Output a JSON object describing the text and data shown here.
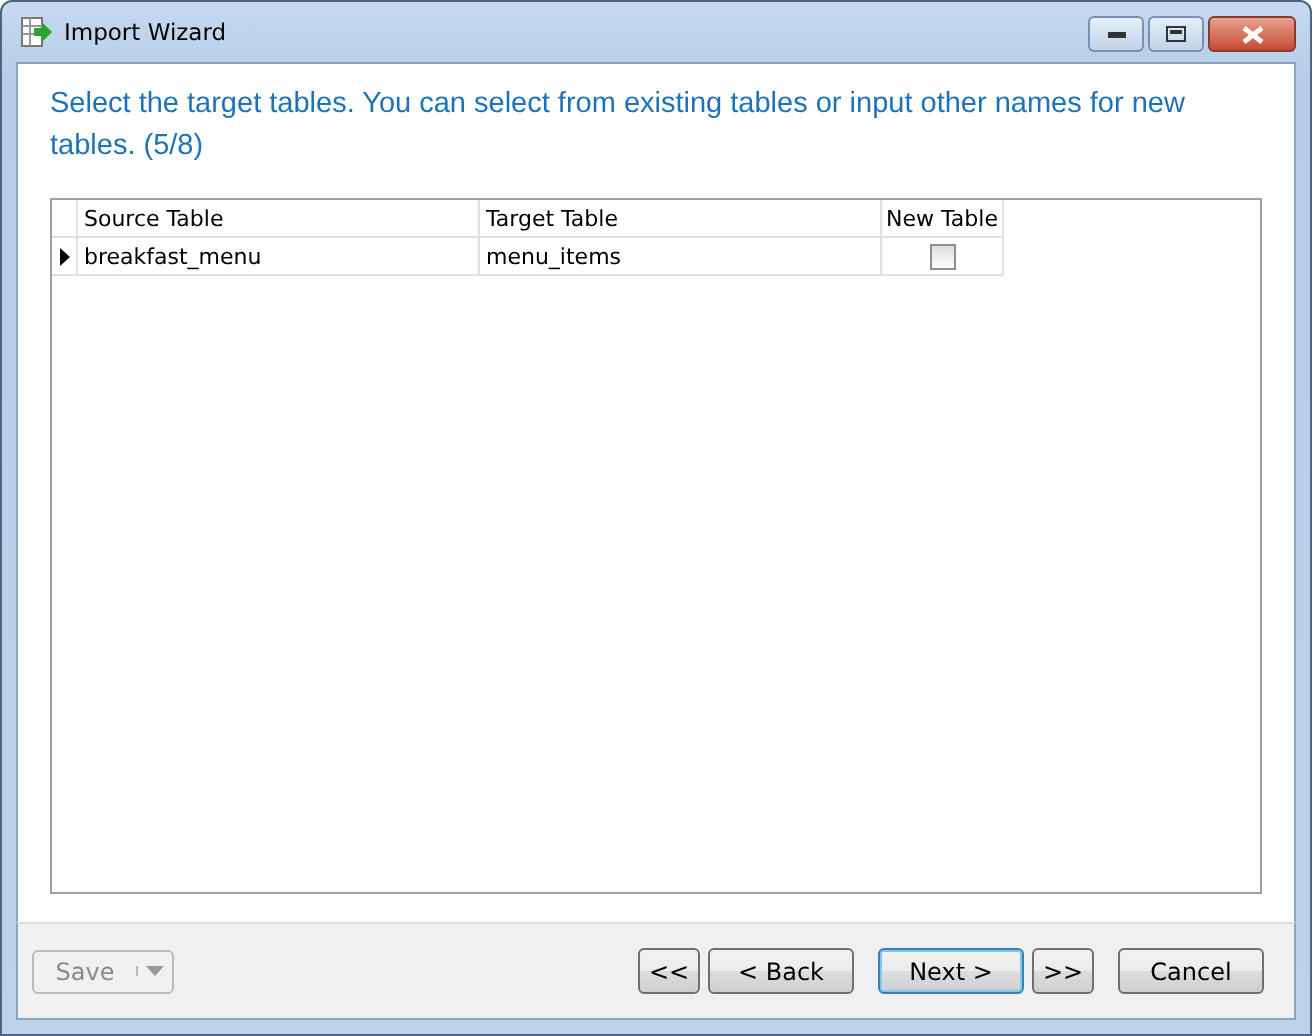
{
  "window": {
    "title": "Import Wizard"
  },
  "instruction": "Select the target tables. You can select from existing tables or input other names for new tables. (5/8)",
  "table": {
    "columns": [
      "Source Table",
      "Target Table",
      "New Table"
    ],
    "rows": [
      {
        "source": "breakfast_menu",
        "target": "menu_items",
        "new_table": false,
        "current": true
      }
    ]
  },
  "save_button": {
    "label": "Save",
    "disabled": true
  },
  "nav_buttons": [
    {
      "label": "<<",
      "default": false
    },
    {
      "label": "< Back",
      "default": false
    },
    {
      "label": "Next >",
      "default": true
    },
    {
      "label": ">>",
      "default": false
    },
    {
      "label": "Cancel",
      "default": false
    }
  ]
}
